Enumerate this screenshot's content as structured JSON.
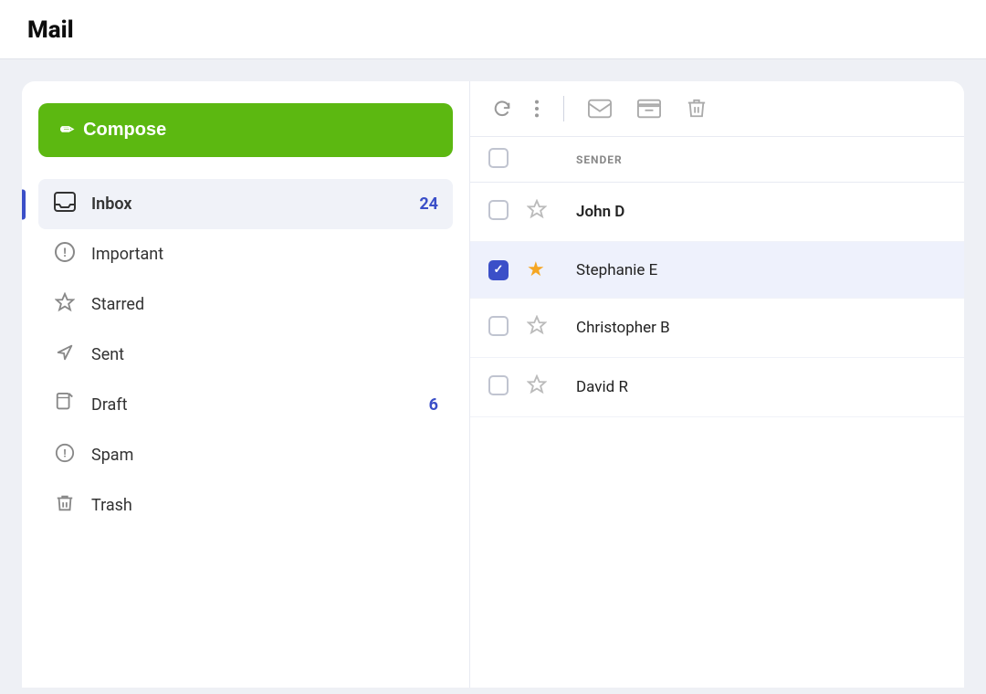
{
  "app": {
    "title": "Mail"
  },
  "sidebar": {
    "compose_label": "Compose",
    "nav_items": [
      {
        "id": "inbox",
        "label": "Inbox",
        "count": "24",
        "icon": "inbox",
        "active": true
      },
      {
        "id": "important",
        "label": "Important",
        "count": "",
        "icon": "important",
        "active": false
      },
      {
        "id": "starred",
        "label": "Starred",
        "count": "",
        "icon": "star",
        "active": false
      },
      {
        "id": "sent",
        "label": "Sent",
        "count": "",
        "icon": "sent",
        "active": false
      },
      {
        "id": "draft",
        "label": "Draft",
        "count": "6",
        "icon": "draft",
        "active": false
      },
      {
        "id": "spam",
        "label": "Spam",
        "count": "",
        "icon": "spam",
        "active": false
      },
      {
        "id": "trash",
        "label": "Trash",
        "count": "",
        "icon": "trash",
        "active": false
      }
    ]
  },
  "mail_list": {
    "toolbar": {
      "refresh_title": "Refresh",
      "more_title": "More options",
      "mark_read_title": "Mark as read",
      "archive_title": "Archive",
      "delete_title": "Delete"
    },
    "header": {
      "sender_label": "SENDER"
    },
    "emails": [
      {
        "id": 1,
        "sender": "John D",
        "checked": false,
        "starred": false,
        "bold": true
      },
      {
        "id": 2,
        "sender": "Stephanie E",
        "checked": true,
        "starred": true,
        "bold": false
      },
      {
        "id": 3,
        "sender": "Christopher B",
        "checked": false,
        "starred": false,
        "bold": false
      },
      {
        "id": 4,
        "sender": "David R",
        "checked": false,
        "starred": false,
        "bold": false
      }
    ]
  }
}
